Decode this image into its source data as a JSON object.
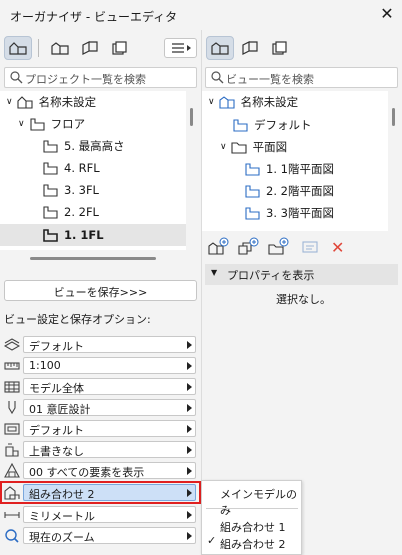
{
  "window": {
    "title": "オーガナイザ - ビューエディタ"
  },
  "left": {
    "search_placeholder": "プロジェクト一覧を検索",
    "tree": [
      {
        "label": "名称未設定",
        "level": 0
      },
      {
        "label": "フロア",
        "level": 1
      },
      {
        "label": "5. 最高高さ",
        "level": 2
      },
      {
        "label": "4. RFL",
        "level": 2
      },
      {
        "label": "3. 3FL",
        "level": 2
      },
      {
        "label": "2. 2FL",
        "level": 2
      },
      {
        "label": "1. 1FL",
        "level": 2,
        "selected": true
      }
    ],
    "save_button": "ビューを保存>>>",
    "options_heading": "ビュー設定と保存オプション:",
    "options": [
      {
        "icon": "layer-icon",
        "value": "デフォルト"
      },
      {
        "icon": "scale-icon",
        "value": "1:100"
      },
      {
        "icon": "model-icon",
        "value": "モデル全体"
      },
      {
        "icon": "pen-icon",
        "value": "01 意匠設計"
      },
      {
        "icon": "override-icon",
        "value": "デフォルト"
      },
      {
        "icon": "renovation-icon",
        "value": "上書きなし"
      },
      {
        "icon": "filter-icon",
        "value": "00 すべての要素を表示"
      },
      {
        "icon": "combination-icon",
        "value": "組み合わせ 2",
        "highlight": true
      },
      {
        "icon": "units-icon",
        "value": "ミリメートル"
      },
      {
        "icon": "zoom-icon",
        "value": "現在のズーム"
      }
    ]
  },
  "right": {
    "search_placeholder": "ビュー一覧を検索",
    "tree": [
      {
        "label": "名称未設定",
        "level": 0
      },
      {
        "label": "デフォルト",
        "level": 1
      },
      {
        "label": "平面図",
        "level": 1
      },
      {
        "label": "1. 1階平面図",
        "level": 2
      },
      {
        "label": "2. 2階平面図",
        "level": 2
      },
      {
        "label": "3. 3階平面図",
        "level": 2
      }
    ],
    "properties_label": "プロパティを表示",
    "no_selection": "選択なし。"
  },
  "dropdown": {
    "items": [
      "メインモデルのみ",
      "組み合わせ 1",
      "組み合わせ 2"
    ],
    "checked": "組み合わせ 2"
  },
  "colors": {
    "accent": "#2b6cc4",
    "highlight_border": "#e02020",
    "highlight_fill": "#cde0f7",
    "delete": "#e0473a"
  }
}
